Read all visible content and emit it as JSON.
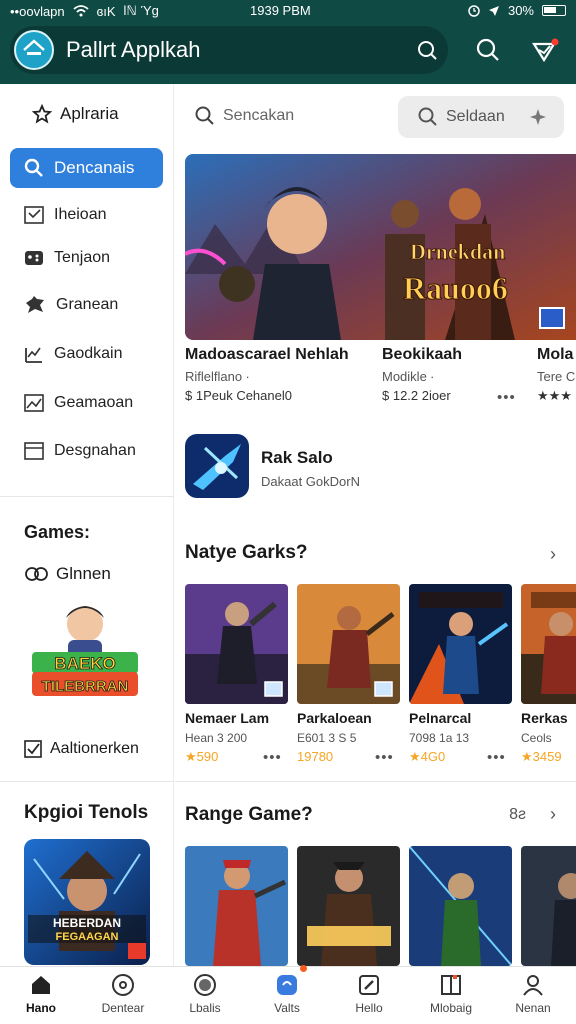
{
  "status_bar": {
    "carrier": "••oovlapn",
    "mid_label": "ɞıK",
    "mid_label2": "lℕ Ύg",
    "time": "1939 PBM",
    "battery": "30%"
  },
  "app_bar": {
    "title": "Pallrt Applkah"
  },
  "sidebar": {
    "header": "Aplraria",
    "active_item": "Dencanais",
    "items": [
      "Iheioan",
      "Tenjaon",
      "Granean",
      "Gaodkain",
      "Geamaoan",
      "Desgnahan"
    ],
    "games_label": "Games:",
    "games_sub": "Glnnen",
    "promo_text": [
      "BAEKO",
      "TILEBRRAN"
    ],
    "check_item": "Aaltionerken",
    "kpgioi_title": "Kpgioi Tenols",
    "kpgioi_art_text": [
      "HEBERDAN",
      "FEGAAGAN"
    ]
  },
  "main": {
    "search_placeholder": "Sencakan",
    "search2_placeholder": "Seldaan",
    "hero_text": [
      "Drnekdan",
      "Rauoo6"
    ],
    "featured": [
      {
        "title": "Madoascarael Nehlah",
        "subtitle": "Riflelflano ∙",
        "price": "$ 1Peuk Cehanel0"
      },
      {
        "title": "Beokikaah",
        "subtitle": "Modikle ∙",
        "price": "$ 12.2 2ioer"
      },
      {
        "title": "Mola",
        "subtitle": "Tere C",
        "rating": "★★★"
      }
    ],
    "app_row": {
      "title": "Rak Salo",
      "subtitle": "Dakaat GokDorN"
    },
    "section1": {
      "title": "Natye Garks?",
      "cards": [
        {
          "title": "Nemaer Lam",
          "sub": "Hean 3 200",
          "rating": "★590"
        },
        {
          "title": "Parkaloean",
          "sub": "E601 3 S 5",
          "rating": "19780"
        },
        {
          "title": "Pelnarcal",
          "sub": "7098 1a 13",
          "rating": "★4G0"
        },
        {
          "title": "Rerkas",
          "sub": "Ceols",
          "rating": "★3459"
        }
      ]
    },
    "section2": {
      "title": "Range Game?",
      "count": "8ƨ"
    }
  },
  "bottom_nav": [
    "Hano",
    "Dentear",
    "Lbalis",
    "Valts",
    "Hello",
    "Mlobaig",
    "Nenan"
  ],
  "colors": {
    "appbar": "#0f4a45",
    "accent": "#2f7fdd",
    "star": "#f5a623"
  }
}
